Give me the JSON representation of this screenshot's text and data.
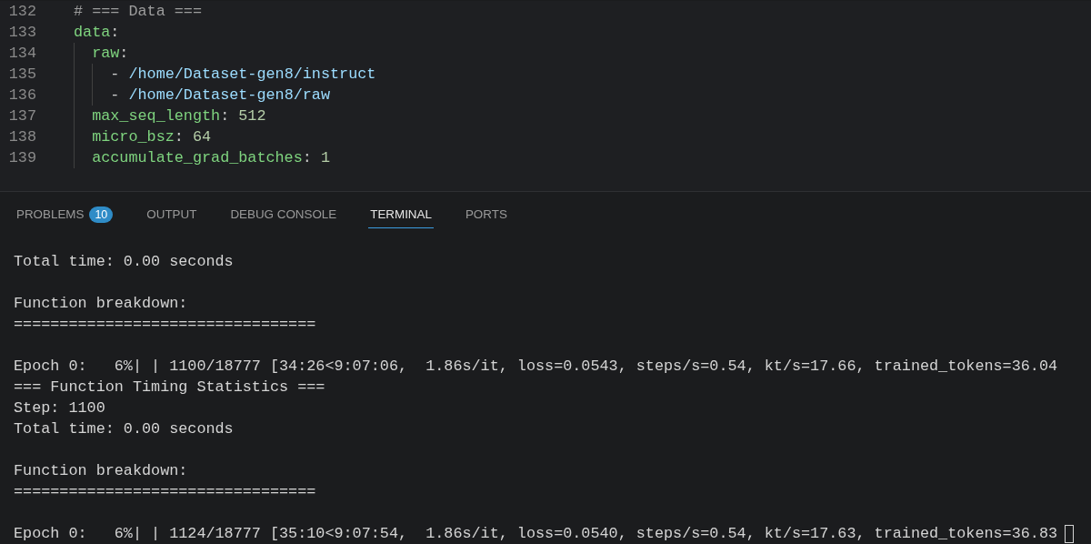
{
  "editor": {
    "lines": [
      {
        "number": "132",
        "tokens": [
          {
            "kind": "comment",
            "text": "# === Data ==="
          }
        ]
      },
      {
        "number": "133",
        "tokens": [
          {
            "kind": "key",
            "text": "data"
          },
          {
            "kind": "punct",
            "text": ":"
          }
        ]
      },
      {
        "number": "134",
        "tokens": [
          {
            "kind": "key",
            "text": "  raw"
          },
          {
            "kind": "punct",
            "text": ":"
          }
        ]
      },
      {
        "number": "135",
        "tokens": [
          {
            "kind": "punct",
            "text": "    - "
          },
          {
            "kind": "string",
            "text": "/home/Dataset-gen8/instruct"
          }
        ]
      },
      {
        "number": "136",
        "tokens": [
          {
            "kind": "punct",
            "text": "    - "
          },
          {
            "kind": "string",
            "text": "/home/Dataset-gen8/raw"
          }
        ]
      },
      {
        "number": "137",
        "tokens": [
          {
            "kind": "key",
            "text": "  max_seq_length"
          },
          {
            "kind": "punct",
            "text": ": "
          },
          {
            "kind": "number",
            "text": "512"
          }
        ]
      },
      {
        "number": "138",
        "tokens": [
          {
            "kind": "key",
            "text": "  micro_bsz"
          },
          {
            "kind": "punct",
            "text": ": "
          },
          {
            "kind": "number",
            "text": "64"
          }
        ]
      },
      {
        "number": "139",
        "tokens": [
          {
            "kind": "key",
            "text": "  accumulate_grad_batches"
          },
          {
            "kind": "punct",
            "text": ": "
          },
          {
            "kind": "number",
            "text": "1"
          }
        ]
      }
    ]
  },
  "panel": {
    "tabs": [
      {
        "label": "PROBLEMS",
        "badge": "10",
        "selected": false
      },
      {
        "label": "OUTPUT",
        "selected": false
      },
      {
        "label": "DEBUG CONSOLE",
        "selected": false
      },
      {
        "label": "TERMINAL",
        "selected": true
      },
      {
        "label": "PORTS",
        "selected": false
      }
    ],
    "terminal": {
      "blocks": [
        {
          "lines": [
            "Total time: 0.00 seconds"
          ]
        },
        {
          "lines": [
            "Function breakdown:",
            "================================="
          ]
        },
        {
          "lines": [
            "Epoch 0:   6%| | 1100/18777 [34:26<9:07:06,  1.86s/it, loss=0.0543, steps/s=0.54, kt/s=17.66, trained_tokens=36.04",
            "=== Function Timing Statistics ===",
            "Step: 1100",
            "Total time: 0.00 seconds"
          ]
        },
        {
          "lines": [
            "Function breakdown:",
            "================================="
          ]
        },
        {
          "lines": [
            "Epoch 0:   6%| | 1124/18777 [35:10<9:07:54,  1.86s/it, loss=0.0540, steps/s=0.54, kt/s=17.63, trained_tokens=36.83"
          ]
        }
      ],
      "cursor": true
    }
  }
}
